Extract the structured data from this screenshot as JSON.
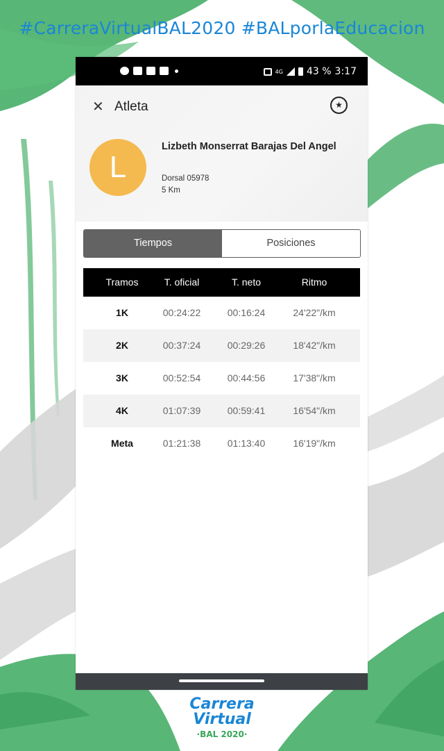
{
  "poster": {
    "hashtag": "#CarreraVirtualBAL2020 #BALporlaEducacion",
    "logo_line1": "Carrera",
    "logo_line2": "Virtual",
    "logo_line3": "·BAL 2020·",
    "colors": {
      "green": "#4fb26f",
      "blue": "#1a86d6",
      "grey": "#d6d6d6"
    }
  },
  "status_bar": {
    "left_icons": [
      "messenger-icon",
      "facebook-icon",
      "youtube-icon",
      "youtube-icon"
    ],
    "network": "4G",
    "battery": "43 %",
    "time": "3:17"
  },
  "app": {
    "title": "Atleta",
    "close_icon": "close-icon",
    "favorite_icon": "star-icon",
    "athlete": {
      "initial": "L",
      "avatar_color": "#f4b94f",
      "name": "Lizbeth Monserrat Barajas Del Angel",
      "dorsal": "Dorsal 05978",
      "distance": "5 Km"
    },
    "tabs": [
      {
        "label": "Tiempos",
        "active": true
      },
      {
        "label": "Posiciones",
        "active": false
      }
    ],
    "table": {
      "headers": [
        "Tramos",
        "T. oficial",
        "T. neto",
        "Ritmo"
      ],
      "rows": [
        {
          "tramo": "1K",
          "oficial": "00:24:22",
          "neto": "00:16:24",
          "ritmo": "24'22\"/km"
        },
        {
          "tramo": "2K",
          "oficial": "00:37:24",
          "neto": "00:29:26",
          "ritmo": "18'42\"/km"
        },
        {
          "tramo": "3K",
          "oficial": "00:52:54",
          "neto": "00:44:56",
          "ritmo": "17'38\"/km"
        },
        {
          "tramo": "4K",
          "oficial": "01:07:39",
          "neto": "00:59:41",
          "ritmo": "16'54\"/km"
        },
        {
          "tramo": "Meta",
          "oficial": "01:21:38",
          "neto": "01:13:40",
          "ritmo": "16'19\"/km"
        }
      ]
    }
  }
}
